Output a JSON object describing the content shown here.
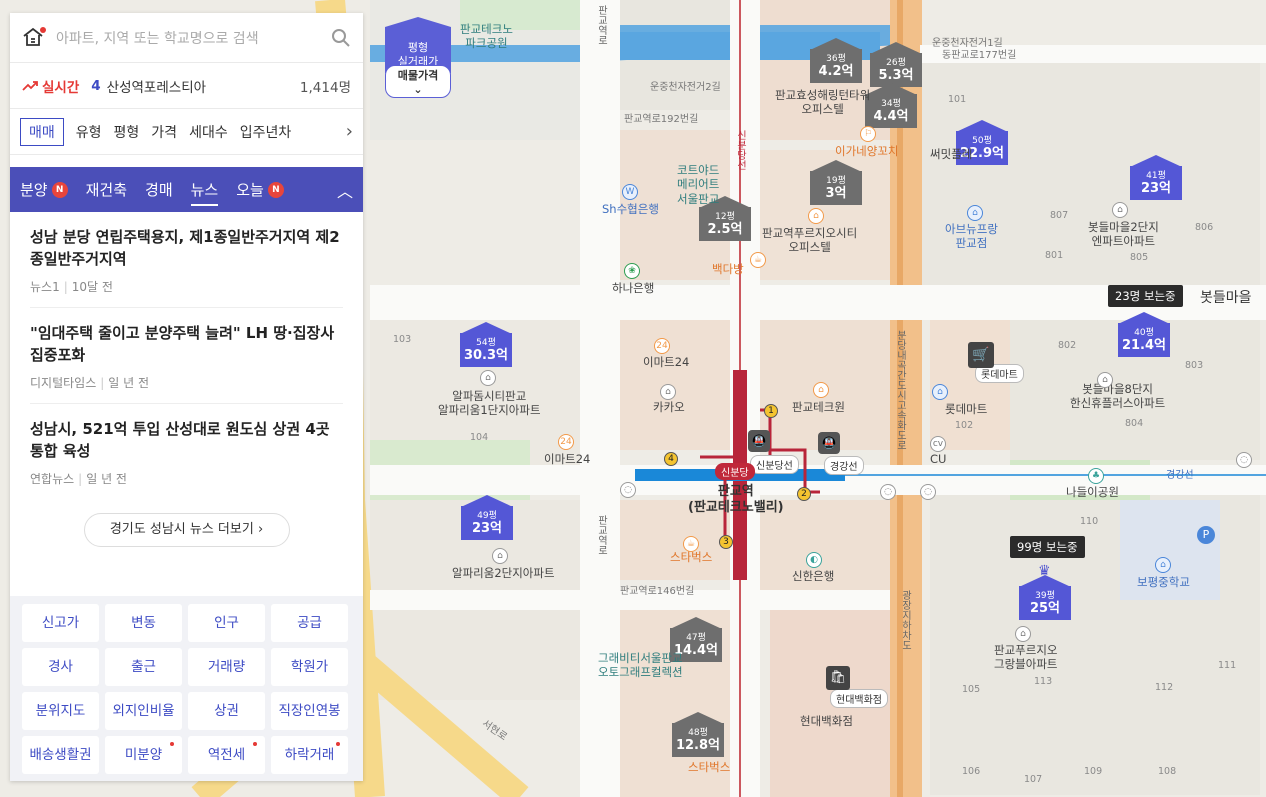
{
  "search": {
    "placeholder": "아파트, 지역 또는 학교명으로 검색"
  },
  "realtime": {
    "label": "실시간",
    "rank": "4",
    "name": "산성역포레스티아",
    "count": "1,414명"
  },
  "filters": {
    "items": [
      "매매",
      "유형",
      "평형",
      "가격",
      "세대수",
      "입주년차"
    ],
    "selected": "매매"
  },
  "categories": {
    "items": [
      "분양",
      "재건축",
      "경매",
      "뉴스",
      "오늘"
    ],
    "active": "뉴스",
    "new_badge": "N"
  },
  "news": [
    {
      "title": "성남 분당 연립주택용지, 제1종일반주거지역 제2종일반주거지역",
      "source": "뉴스1",
      "time": "10달 전"
    },
    {
      "title": "\"임대주택 줄이고 분양주택 늘려\" LH 땅·집장사 집중포화",
      "source": "디지털타임스",
      "time": "일 년 전"
    },
    {
      "title": "성남시, 521억 투입 산성대로 원도심 상권 4곳 통합 육성",
      "source": "연합뉴스",
      "time": "일 년 전"
    }
  ],
  "more_button": "경기도 성남시 뉴스 더보기",
  "quick_menu": [
    "신고가",
    "변동",
    "인구",
    "공급",
    "경사",
    "출근",
    "거래량",
    "학원가",
    "분위지도",
    "외지인비율",
    "상권",
    "직장인연봉",
    "배송생활권",
    "미분양",
    "역전세",
    "하락거래"
  ],
  "quick_menu_dots": [
    "미분양",
    "역전세",
    "하락거래"
  ],
  "map": {
    "realdeal": {
      "line1": "평형",
      "line2": "실거래가",
      "select": "매물가격"
    },
    "markers": [
      {
        "py": "36평",
        "price": "4.2억",
        "color": "gray"
      },
      {
        "py": "26평",
        "price": "5.3억",
        "color": "gray"
      },
      {
        "py": "34평",
        "price": "4.4억",
        "color": "gray"
      },
      {
        "py": "50평",
        "price": "22.9억",
        "color": "blue"
      },
      {
        "py": "41평",
        "price": "23억",
        "color": "blue"
      },
      {
        "py": "19평",
        "price": "3억",
        "color": "gray"
      },
      {
        "py": "12평",
        "price": "2.5억",
        "color": "gray"
      },
      {
        "py": "54평",
        "price": "30.3억",
        "color": "blue"
      },
      {
        "py": "40평",
        "price": "21.4억",
        "color": "blue"
      },
      {
        "py": "49평",
        "price": "23억",
        "color": "blue"
      },
      {
        "py": "39평",
        "price": "25억",
        "color": "blue"
      },
      {
        "py": "47평",
        "price": "14.4억",
        "color": "gray"
      },
      {
        "py": "48평",
        "price": "12.8억",
        "color": "gray"
      }
    ],
    "viewers": [
      "23명 보는중",
      "99명 보는중"
    ],
    "labels": {
      "pangyo_techno_park": "판교테크노\n파크공원",
      "pangyo_hyosung": "판교효성해링턴타워\n오피스텔",
      "ikaneya": "이가네양꼬치",
      "sseomit": "써밋플레",
      "courtyard": "코트야드\n메리어트\n서울판교",
      "sh_bank": "Sh수협은행",
      "pangyo_prugio": "판교역푸르지오시티\n오피스텔",
      "baekdabang": "백다방",
      "hana_bank": "하나은행",
      "abyu": "아브뉴프랑\n판교점",
      "botdeul2": "봇들마을2단지\n엔파트아파트",
      "botdeul": "봇들마을",
      "emart24a": "이마트24",
      "kakao": "카카오",
      "pangyo_techone": "판교테크원",
      "alphadome": "알파돔시티판교\n알파리움1단지아파트",
      "emart24b": "이마트24",
      "lotte_mart": "롯데마트",
      "botdeul8": "봇들마을8단지\n한신휴플러스아파트",
      "cu": "CU",
      "nadeul": "나들이공원",
      "station": "판교역\n(판교테크노밸리)",
      "starbucks1": "스타벅스",
      "shinhan": "신한은행",
      "alphadome2": "알파리움2단지아파트",
      "bopyeong": "보평중학교",
      "prugio_grand": "판교푸르지오\n그랑블아파트",
      "gravity": "그래비티서울판교\n오토그래프컬렉션",
      "hyundai_tag": "현대백화점",
      "hyundai": "현대백화점",
      "starbucks2": "스타벅스",
      "shinbundang_tag": "신분당선",
      "gyeonggang_tag": "경강선",
      "gyeonggang_line": "경강선",
      "shinbundang_badge": "신분당",
      "lotte_mart_tag": "롯데마트"
    },
    "roads": {
      "pangyo_ro_192": "판교역로192번길",
      "pangyo_ro_146": "판교역로146번길",
      "dongpangyo_177": "동판교로177번길",
      "unjung_14": "운중천자전거1길",
      "unjung_2": "운중천자전거2길",
      "bundang_ro": "분당내곡간도시고속화도로",
      "gwangjang": "광장지하차도",
      "seohyeon": "서현로",
      "pangyo_yeokro": "판교역로",
      "shinbundang_v": "신분당선",
      "pangyo_ro_v": "판교역로"
    },
    "block_numbers": [
      "101",
      "102",
      "103",
      "104",
      "105",
      "106",
      "107",
      "108",
      "109",
      "110",
      "111",
      "112",
      "113",
      "801",
      "802",
      "803",
      "804",
      "805",
      "806",
      "807"
    ]
  }
}
